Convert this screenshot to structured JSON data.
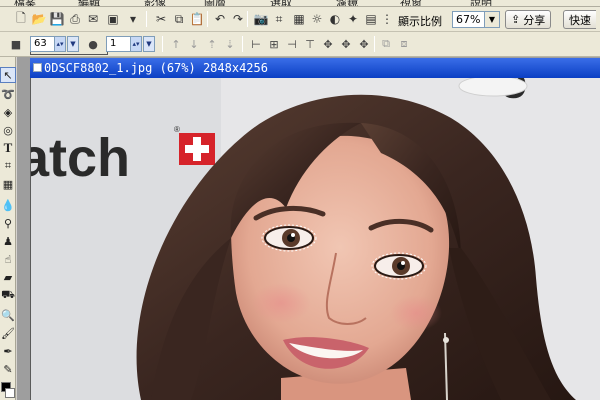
{
  "menubar": {
    "items": [
      "檔案",
      "編輯",
      "影像",
      "圖層",
      "選取",
      "濾鏡",
      "視窗",
      "說明"
    ]
  },
  "toolbar": {
    "zoom_label": "顯示比例",
    "zoom_value": "67%",
    "share_label": "分享",
    "quick_label": "快速"
  },
  "options_bar": {
    "size_value": "63",
    "opacity_value": "1"
  },
  "document": {
    "title": "0DSCF8802_1.jpg (67%) 2848x4256",
    "brand_text": "atch"
  },
  "colors": {
    "title_bar": "#1a4fd6",
    "toolbar_bg": "#ece9d8",
    "brand_red": "#d6232a",
    "background_wall": "#e6e6e8"
  },
  "icons": {
    "toolbar1": [
      "new-icon",
      "open-icon",
      "save-icon",
      "print-icon",
      "email-icon",
      "scan-icon",
      "cut-icon",
      "copy-icon",
      "paste-icon",
      "undo-icon",
      "redo-icon",
      "screenshot-icon",
      "crop-icon",
      "brightness-icon",
      "color-icon",
      "effects-icon",
      "frame-icon"
    ],
    "tools": [
      "arrow-icon",
      "lasso-icon",
      "eraser-icon",
      "clone-icon",
      "text-icon",
      "crop-icon",
      "grid-icon",
      "blur-icon",
      "dropper-icon",
      "stamp-icon",
      "smudge-icon",
      "eraser2-icon",
      "fill-icon",
      "zoom-icon",
      "brush-icon",
      "pen-icon",
      "pencil-icon"
    ]
  }
}
